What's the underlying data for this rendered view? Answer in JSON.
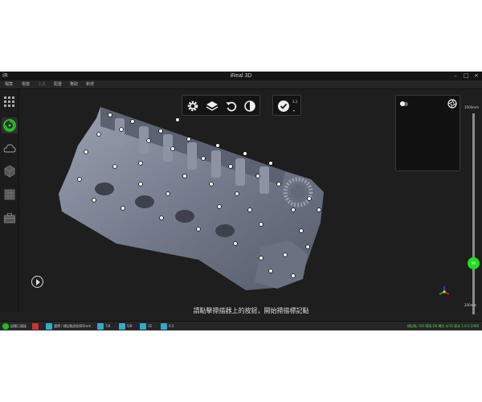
{
  "window": {
    "title": "iReal 3D",
    "logo": "iR"
  },
  "menu": [
    "檔案",
    "視窗",
    "工具",
    "配置",
    "幫助",
    "新增"
  ],
  "viewport": {
    "instruction": "請點擊掃描器上的按鈕，開始掃描標記點",
    "capture_label": "3.2",
    "slider": {
      "top_label": "1000mm",
      "bottom_label": "200mm",
      "value_label": "95",
      "level": 0.24
    }
  },
  "statusbar": {
    "items": [
      "設備已連接",
      "",
      "選擇 / 標記點與對齊5mm",
      "7/4",
      "5/8",
      "32",
      "0.2"
    ],
    "right_text": "標記點: 0/0 環境 OK 曝光 4/10 版本 1.0.0.2468"
  },
  "colors": {
    "accent": "#22dd22",
    "model": "#7d8595",
    "background": "#1e1e1e"
  },
  "icons": [
    "grid-icon",
    "scan-icon",
    "cloud-icon",
    "mesh-icon",
    "texture-icon",
    "toolbox-icon",
    "gear-icon",
    "layers-icon",
    "reset-icon",
    "contrast-icon",
    "check-icon",
    "camera-icon",
    "play-icon",
    "axis-icon"
  ]
}
